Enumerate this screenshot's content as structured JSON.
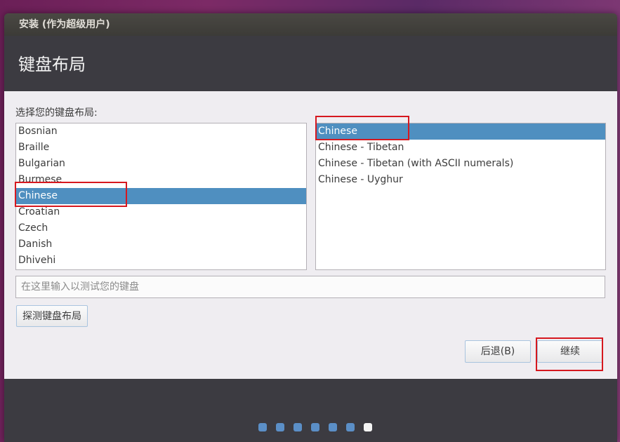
{
  "window": {
    "title": "安装 (作为超级用户)"
  },
  "header": {
    "title": "键盘布局"
  },
  "main": {
    "section_label": "选择您的键盘布局:",
    "layouts": [
      {
        "label": "Bosnian",
        "selected": false
      },
      {
        "label": "Braille",
        "selected": false
      },
      {
        "label": "Bulgarian",
        "selected": false
      },
      {
        "label": "Burmese",
        "selected": false
      },
      {
        "label": "Chinese",
        "selected": true
      },
      {
        "label": "Croatian",
        "selected": false
      },
      {
        "label": "Czech",
        "selected": false
      },
      {
        "label": "Danish",
        "selected": false
      },
      {
        "label": "Dhivehi",
        "selected": false
      }
    ],
    "variants": [
      {
        "label": "Chinese",
        "selected": true
      },
      {
        "label": "Chinese - Tibetan",
        "selected": false
      },
      {
        "label": "Chinese - Tibetan (with ASCII numerals)",
        "selected": false
      },
      {
        "label": "Chinese - Uyghur",
        "selected": false
      }
    ],
    "test_input": {
      "value": "",
      "placeholder": "在这里输入以测试您的键盘"
    },
    "detect_button_label": "探测键盘布局",
    "back_button_label": "后退(B)",
    "continue_button_label": "继续"
  },
  "footer": {
    "progress_step_count": 7,
    "progress_active_step": 7
  },
  "colors": {
    "selection": "#4f8fc0",
    "active_dot": "#f4f4f4",
    "inactive_dot": "#5b8fc7",
    "annotation_box": "#d6181f"
  }
}
